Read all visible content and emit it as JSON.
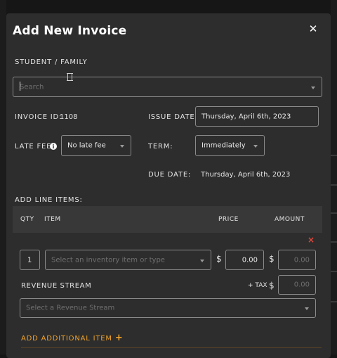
{
  "modal": {
    "title": "Add New Invoice",
    "close_icon": "close-icon"
  },
  "student_family": {
    "label": "STUDENT / FAMILY",
    "placeholder": "Search"
  },
  "invoice": {
    "id_label": "INVOICE ID:",
    "id_value": "1108",
    "issue_date_label": "ISSUE DATE:",
    "issue_date_value": "Thursday, April 6th, 2023",
    "late_fee_label": "LATE FEE:",
    "late_fee_value": "No late fee",
    "term_label": "TERM:",
    "term_value": "Immediately",
    "due_date_label": "DUE DATE:",
    "due_date_value": "Thursday, April 6th, 2023"
  },
  "line_items": {
    "section_label": "ADD LINE ITEMS:",
    "headers": {
      "qty": "QTY",
      "item": "ITEM",
      "price": "PRICE",
      "amount": "AMOUNT"
    },
    "row": {
      "qty": "1",
      "item_placeholder": "Select an inventory item or type",
      "currency": "$",
      "price": "0.00",
      "amount": "0.00",
      "revenue_stream_label": "REVENUE STREAM",
      "tax_label": "+ TAX",
      "tax": "0.00",
      "revenue_stream_placeholder": "Select a Revenue Stream",
      "remove_icon": "×"
    },
    "add_label": "ADD ADDITIONAL ITEM",
    "add_icon": "+"
  },
  "colors": {
    "modal_bg": "#2d2d2d",
    "accent_orange": "#f0a32c",
    "remove_red": "#e0473a"
  }
}
